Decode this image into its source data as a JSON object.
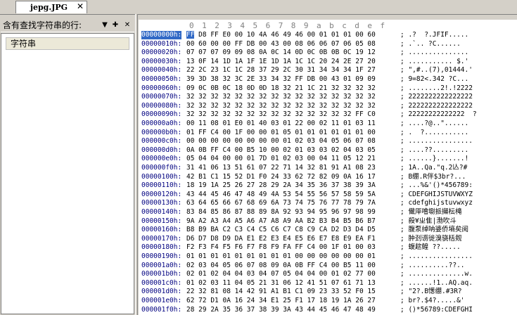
{
  "tab": {
    "label": "jepg.JPG",
    "close": "✕"
  },
  "left_panel": {
    "title": "含有查找字符串的行:",
    "pin_icon": "pin-icon",
    "close_icon": "close-icon",
    "column_header": "字符串"
  },
  "ruler": [
    "0",
    "1",
    "2",
    "3",
    "4",
    "5",
    "6",
    "7",
    "8",
    "9",
    "a",
    "b",
    "c",
    "d",
    "e",
    "f"
  ],
  "rows": [
    {
      "addr": "00000000h:",
      "bytes": "FF D8 FF E0 00 10 4A 46 49 46 00 01 01 01 00 60",
      "ascii": "; .?  ?.JFIF....."
    },
    {
      "addr": "00000010h:",
      "bytes": "00 60 00 00 FF DB 00 43 00 08 06 06 07 06 05 08",
      "ascii": "; .`.. ?C......"
    },
    {
      "addr": "00000020h:",
      "bytes": "07 07 07 09 09 08 0A 0C 14 0D 0C 0B 0B 0C 19 12",
      "ascii": "; ..............."
    },
    {
      "addr": "00000030h:",
      "bytes": "13 0F 14 1D 1A 1F 1E 1D 1A 1C 1C 20 24 2E 27 20",
      "ascii": "; ........... $.'"
    },
    {
      "addr": "00000040h:",
      "bytes": "22 2C 23 1C 1C 28 37 29 2C 30 31 34 34 34 1F 27",
      "ascii": "; \",#..(7),01444.'"
    },
    {
      "addr": "00000050h:",
      "bytes": "39 3D 38 32 3C 2E 33 34 32 FF DB 00 43 01 09 09",
      "ascii": "; 9=82<.342 ?C..."
    },
    {
      "addr": "00000060h:",
      "bytes": "09 0C 0B 0C 18 0D 0D 18 32 21 1C 21 32 32 32 32",
      "ascii": "; ........2!.!2222"
    },
    {
      "addr": "00000070h:",
      "bytes": "32 32 32 32 32 32 32 32 32 32 32 32 32 32 32 32",
      "ascii": "; 2222222222222222"
    },
    {
      "addr": "00000080h:",
      "bytes": "32 32 32 32 32 32 32 32 32 32 32 32 32 32 32 32",
      "ascii": "; 2222222222222222"
    },
    {
      "addr": "00000090h:",
      "bytes": "32 32 32 32 32 32 32 32 32 32 32 32 32 32 FF C0",
      "ascii": "; 22222222222222  ?"
    },
    {
      "addr": "000000a0h:",
      "bytes": "00 11 08 01 E0 01 40 03 01 22 00 02 11 01 03 11",
      "ascii": "; ....?@..\"......"
    },
    {
      "addr": "000000b0h:",
      "bytes": "01 FF C4 00 1F 00 00 01 05 01 01 01 01 01 01 00",
      "ascii": "; .  ?..........."
    },
    {
      "addr": "000000c0h:",
      "bytes": "00 00 00 00 00 00 00 00 01 02 03 04 05 06 07 08",
      "ascii": "; ................"
    },
    {
      "addr": "000000d0h:",
      "bytes": "0A 0B FF C4 00 B5 10 00 02 01 03 03 02 04 03 05",
      "ascii": "; ....??........."
    },
    {
      "addr": "000000e0h:",
      "bytes": "05 04 04 00 00 01 7D 01 02 03 00 04 11 05 12 21",
      "ascii": "; ......}.......!"
    },
    {
      "addr": "000000f0h:",
      "bytes": "31 41 06 13 51 61 07 22 71 14 32 81 91 A1 08 23",
      "ascii": "; 1A..Qa.\"q.2亾?#"
    },
    {
      "addr": "00000100h:",
      "bytes": "42 B1 C1 15 52 D1 F0 24 33 62 72 82 09 0A 16 17",
      "ascii": "; B绷.R伴$3br?..."
    },
    {
      "addr": "00000110h:",
      "bytes": "18 19 1A 25 26 27 28 29 2A 34 35 36 37 38 39 3A",
      "ascii": "; ...%&'()*456789:"
    },
    {
      "addr": "00000120h:",
      "bytes": "43 44 45 46 47 48 49 4A 53 54 55 56 57 58 59 5A",
      "ascii": "; CDEFGHIJSTUVWXYZ"
    },
    {
      "addr": "00000130h:",
      "bytes": "63 64 65 66 67 68 69 6A 73 74 75 76 77 78 79 7A",
      "ascii": "; cdefghijstuvwxyz"
    },
    {
      "addr": "00000140h:",
      "bytes": "83 84 85 86 87 88 89 8A 92 93 94 95 96 97 98 99",
      "ascii": "; 儎厗噲墛挀攧枟槞"
    },
    {
      "addr": "00000150h:",
      "bytes": "9A A2 A3 A4 A5 A6 A7 A8 A9 AA B2 B3 B4 B5 B6 B7",
      "ascii": "; 殺¥ㄓ隹|渤吹斗"
    },
    {
      "addr": "00000160h:",
      "bytes": "B8 B9 BA C2 C3 C4 C5 C6 C7 C8 C9 CA D2 D3 D4 D5",
      "ascii": "; 腹泵绰呐婆侨墒矣阅"
    },
    {
      "addr": "00000170h:",
      "bytes": "D6 D7 D8 D9 DA E1 E2 E3 E4 E5 E6 E7 E8 E9 EA F1",
      "ascii": "; 肿刭谫徙溴骁栝觌"
    },
    {
      "addr": "00000180h:",
      "bytes": "F2 F3 F4 F5 F6 F7 F8 F9 FA FF C4 00 1F 01 00 03",
      "ascii": "; 蝮趑鳇 ??....."
    },
    {
      "addr": "00000190h:",
      "bytes": "01 01 01 01 01 01 01 01 01 00 00 00 00 00 00 01",
      "ascii": "; ................"
    },
    {
      "addr": "000001a0h:",
      "bytes": "02 03 04 05 06 07 08 09 0A 0B FF C4 00 B5 11 00",
      "ascii": "; ..........??.."
    },
    {
      "addr": "000001b0h:",
      "bytes": "02 01 02 04 04 03 04 07 05 04 04 00 01 02 77 00",
      "ascii": "; ..............w."
    },
    {
      "addr": "000001c0h:",
      "bytes": "01 02 03 11 04 05 21 31 06 12 41 51 07 61 71 13",
      "ascii": "; ......!1..AQ.aq."
    },
    {
      "addr": "000001d0h:",
      "bytes": "22 32 81 08 14 42 91 A1 B1 C1 09 23 33 52 F0 15",
      "ascii": "; \"2?.B憽绷.#3R?"
    },
    {
      "addr": "000001e0h:",
      "bytes": "62 72 D1 0A 16 24 34 E1 25 F1 17 18 19 1A 26 27",
      "ascii": "; br?.$4?.....&'"
    },
    {
      "addr": "000001f0h:",
      "bytes": "28 29 2A 35 36 37 38 39 3A 43 44 45 46 47 48 49",
      "ascii": "; ()*56789:CDEFGHI"
    }
  ]
}
